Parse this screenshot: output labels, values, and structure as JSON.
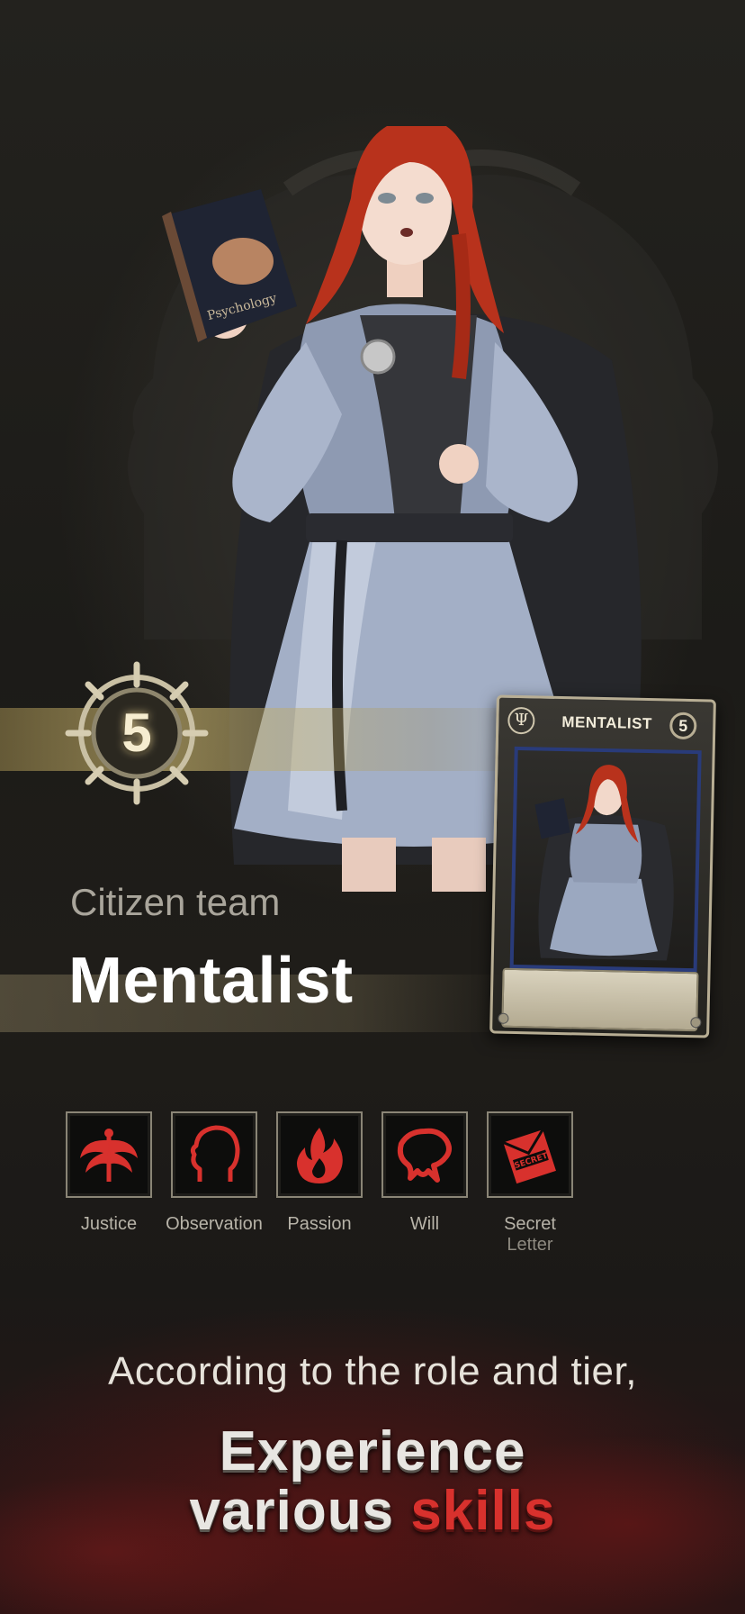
{
  "tier": {
    "value": "5"
  },
  "card": {
    "symbol": "Ψ",
    "title": "MENTALIST",
    "tier": "5"
  },
  "role": {
    "team": "Citizen team",
    "name": "Mentalist"
  },
  "skills": [
    {
      "label": "Justice",
      "icon": "justice-icon"
    },
    {
      "label": "Observation",
      "icon": "observation-icon"
    },
    {
      "label": "Passion",
      "icon": "passion-icon"
    },
    {
      "label": "Will",
      "icon": "will-icon"
    },
    {
      "label": "Secret",
      "label2": "Letter",
      "icon": "secret-letter-icon",
      "icon_text": "SECRET"
    }
  ],
  "book": {
    "cover_text": "Psychology"
  },
  "tagline": {
    "sub": "According to the role and tier,",
    "line1": "Experience",
    "line2_plain": "various",
    "line2_accent": "skills"
  },
  "colors": {
    "accent_red": "#d8312d",
    "card_frame": "#b8ae94",
    "card_border": "#293b7a"
  }
}
